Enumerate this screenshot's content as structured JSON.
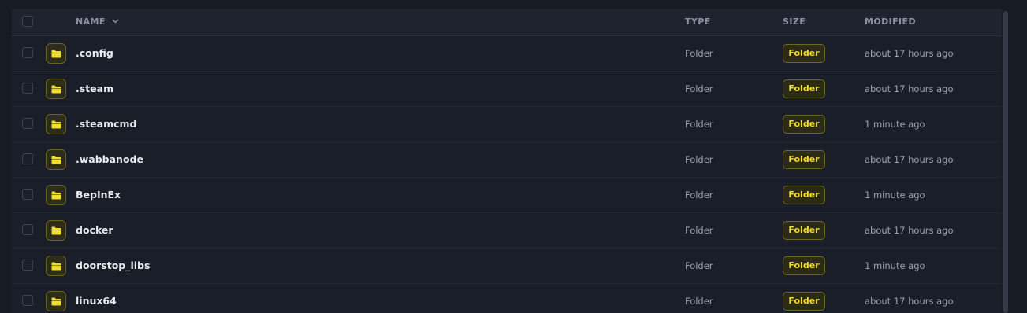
{
  "header": {
    "name": "NAME",
    "type": "TYPE",
    "size": "SIZE",
    "modified": "MODIFIED"
  },
  "colors": {
    "accent": "#f0dd2e",
    "background": "#171b24",
    "header_bg": "#1e2330"
  },
  "icons": {
    "sort": "chevron-down-icon",
    "folder": "folder-icon"
  },
  "rows": [
    {
      "name": ".config",
      "type": "Folder",
      "size": "Folder",
      "modified": "about 17 hours ago"
    },
    {
      "name": ".steam",
      "type": "Folder",
      "size": "Folder",
      "modified": "about 17 hours ago"
    },
    {
      "name": ".steamcmd",
      "type": "Folder",
      "size": "Folder",
      "modified": "1 minute ago"
    },
    {
      "name": ".wabbanode",
      "type": "Folder",
      "size": "Folder",
      "modified": "about 17 hours ago"
    },
    {
      "name": "BepInEx",
      "type": "Folder",
      "size": "Folder",
      "modified": "1 minute ago"
    },
    {
      "name": "docker",
      "type": "Folder",
      "size": "Folder",
      "modified": "about 17 hours ago"
    },
    {
      "name": "doorstop_libs",
      "type": "Folder",
      "size": "Folder",
      "modified": "1 minute ago"
    },
    {
      "name": "linux64",
      "type": "Folder",
      "size": "Folder",
      "modified": "about 17 hours ago"
    }
  ]
}
